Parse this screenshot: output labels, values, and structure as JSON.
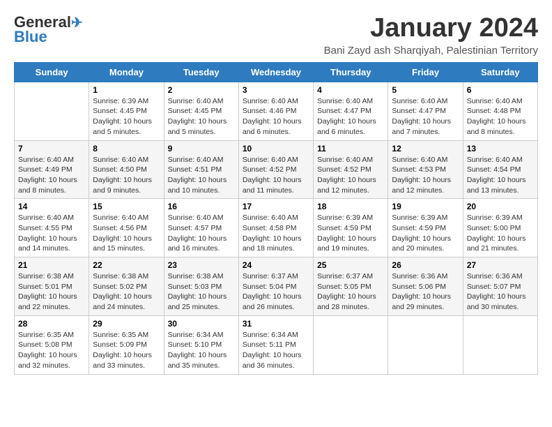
{
  "header": {
    "logo_line1": "General",
    "logo_line2": "Blue",
    "month_title": "January 2024",
    "location": "Bani Zayd ash Sharqiyah, Palestinian Territory"
  },
  "days_of_week": [
    "Sunday",
    "Monday",
    "Tuesday",
    "Wednesday",
    "Thursday",
    "Friday",
    "Saturday"
  ],
  "weeks": [
    [
      {
        "day": "",
        "sunrise": "",
        "sunset": "",
        "daylight": ""
      },
      {
        "day": "1",
        "sunrise": "Sunrise: 6:39 AM",
        "sunset": "Sunset: 4:45 PM",
        "daylight": "Daylight: 10 hours and 5 minutes."
      },
      {
        "day": "2",
        "sunrise": "Sunrise: 6:40 AM",
        "sunset": "Sunset: 4:45 PM",
        "daylight": "Daylight: 10 hours and 5 minutes."
      },
      {
        "day": "3",
        "sunrise": "Sunrise: 6:40 AM",
        "sunset": "Sunset: 4:46 PM",
        "daylight": "Daylight: 10 hours and 6 minutes."
      },
      {
        "day": "4",
        "sunrise": "Sunrise: 6:40 AM",
        "sunset": "Sunset: 4:47 PM",
        "daylight": "Daylight: 10 hours and 6 minutes."
      },
      {
        "day": "5",
        "sunrise": "Sunrise: 6:40 AM",
        "sunset": "Sunset: 4:47 PM",
        "daylight": "Daylight: 10 hours and 7 minutes."
      },
      {
        "day": "6",
        "sunrise": "Sunrise: 6:40 AM",
        "sunset": "Sunset: 4:48 PM",
        "daylight": "Daylight: 10 hours and 8 minutes."
      }
    ],
    [
      {
        "day": "7",
        "sunrise": "Sunrise: 6:40 AM",
        "sunset": "Sunset: 4:49 PM",
        "daylight": "Daylight: 10 hours and 8 minutes."
      },
      {
        "day": "8",
        "sunrise": "Sunrise: 6:40 AM",
        "sunset": "Sunset: 4:50 PM",
        "daylight": "Daylight: 10 hours and 9 minutes."
      },
      {
        "day": "9",
        "sunrise": "Sunrise: 6:40 AM",
        "sunset": "Sunset: 4:51 PM",
        "daylight": "Daylight: 10 hours and 10 minutes."
      },
      {
        "day": "10",
        "sunrise": "Sunrise: 6:40 AM",
        "sunset": "Sunset: 4:52 PM",
        "daylight": "Daylight: 10 hours and 11 minutes."
      },
      {
        "day": "11",
        "sunrise": "Sunrise: 6:40 AM",
        "sunset": "Sunset: 4:52 PM",
        "daylight": "Daylight: 10 hours and 12 minutes."
      },
      {
        "day": "12",
        "sunrise": "Sunrise: 6:40 AM",
        "sunset": "Sunset: 4:53 PM",
        "daylight": "Daylight: 10 hours and 12 minutes."
      },
      {
        "day": "13",
        "sunrise": "Sunrise: 6:40 AM",
        "sunset": "Sunset: 4:54 PM",
        "daylight": "Daylight: 10 hours and 13 minutes."
      }
    ],
    [
      {
        "day": "14",
        "sunrise": "Sunrise: 6:40 AM",
        "sunset": "Sunset: 4:55 PM",
        "daylight": "Daylight: 10 hours and 14 minutes."
      },
      {
        "day": "15",
        "sunrise": "Sunrise: 6:40 AM",
        "sunset": "Sunset: 4:56 PM",
        "daylight": "Daylight: 10 hours and 15 minutes."
      },
      {
        "day": "16",
        "sunrise": "Sunrise: 6:40 AM",
        "sunset": "Sunset: 4:57 PM",
        "daylight": "Daylight: 10 hours and 16 minutes."
      },
      {
        "day": "17",
        "sunrise": "Sunrise: 6:40 AM",
        "sunset": "Sunset: 4:58 PM",
        "daylight": "Daylight: 10 hours and 18 minutes."
      },
      {
        "day": "18",
        "sunrise": "Sunrise: 6:39 AM",
        "sunset": "Sunset: 4:59 PM",
        "daylight": "Daylight: 10 hours and 19 minutes."
      },
      {
        "day": "19",
        "sunrise": "Sunrise: 6:39 AM",
        "sunset": "Sunset: 4:59 PM",
        "daylight": "Daylight: 10 hours and 20 minutes."
      },
      {
        "day": "20",
        "sunrise": "Sunrise: 6:39 AM",
        "sunset": "Sunset: 5:00 PM",
        "daylight": "Daylight: 10 hours and 21 minutes."
      }
    ],
    [
      {
        "day": "21",
        "sunrise": "Sunrise: 6:38 AM",
        "sunset": "Sunset: 5:01 PM",
        "daylight": "Daylight: 10 hours and 22 minutes."
      },
      {
        "day": "22",
        "sunrise": "Sunrise: 6:38 AM",
        "sunset": "Sunset: 5:02 PM",
        "daylight": "Daylight: 10 hours and 24 minutes."
      },
      {
        "day": "23",
        "sunrise": "Sunrise: 6:38 AM",
        "sunset": "Sunset: 5:03 PM",
        "daylight": "Daylight: 10 hours and 25 minutes."
      },
      {
        "day": "24",
        "sunrise": "Sunrise: 6:37 AM",
        "sunset": "Sunset: 5:04 PM",
        "daylight": "Daylight: 10 hours and 26 minutes."
      },
      {
        "day": "25",
        "sunrise": "Sunrise: 6:37 AM",
        "sunset": "Sunset: 5:05 PM",
        "daylight": "Daylight: 10 hours and 28 minutes."
      },
      {
        "day": "26",
        "sunrise": "Sunrise: 6:36 AM",
        "sunset": "Sunset: 5:06 PM",
        "daylight": "Daylight: 10 hours and 29 minutes."
      },
      {
        "day": "27",
        "sunrise": "Sunrise: 6:36 AM",
        "sunset": "Sunset: 5:07 PM",
        "daylight": "Daylight: 10 hours and 30 minutes."
      }
    ],
    [
      {
        "day": "28",
        "sunrise": "Sunrise: 6:35 AM",
        "sunset": "Sunset: 5:08 PM",
        "daylight": "Daylight: 10 hours and 32 minutes."
      },
      {
        "day": "29",
        "sunrise": "Sunrise: 6:35 AM",
        "sunset": "Sunset: 5:09 PM",
        "daylight": "Daylight: 10 hours and 33 minutes."
      },
      {
        "day": "30",
        "sunrise": "Sunrise: 6:34 AM",
        "sunset": "Sunset: 5:10 PM",
        "daylight": "Daylight: 10 hours and 35 minutes."
      },
      {
        "day": "31",
        "sunrise": "Sunrise: 6:34 AM",
        "sunset": "Sunset: 5:11 PM",
        "daylight": "Daylight: 10 hours and 36 minutes."
      },
      {
        "day": "",
        "sunrise": "",
        "sunset": "",
        "daylight": ""
      },
      {
        "day": "",
        "sunrise": "",
        "sunset": "",
        "daylight": ""
      },
      {
        "day": "",
        "sunrise": "",
        "sunset": "",
        "daylight": ""
      }
    ]
  ]
}
